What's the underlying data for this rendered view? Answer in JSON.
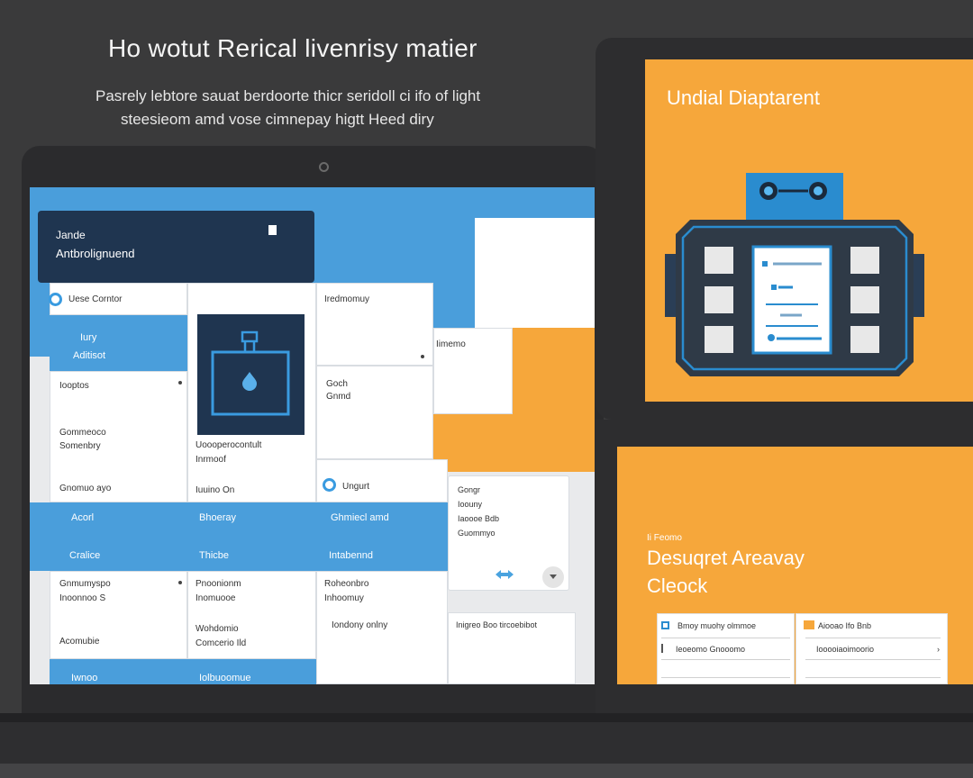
{
  "page": {
    "headline": "Ho wotut Rerical livenrisy matier",
    "subline_1": "Pasrely lebtore sauat berdoorte thicr seridoll ci ifo of light",
    "subline_2": "steesieom amd vose cimnepay higtt Heed diry"
  },
  "laptop": {
    "dark_card": {
      "line1": "Jande",
      "line2": "Antbrolignuend"
    },
    "row1": {
      "radio_label": "Uese Corntor",
      "mid_label": "Iredmomuy",
      "right_label": "Iimemo"
    },
    "col1": {
      "item1_a": "Iury",
      "item1_b": "Aditisot",
      "item2": "Iooptos",
      "item3_a": "Gommeoco",
      "item3_b": "Somenbry",
      "item4": "Gnomuo ayo"
    },
    "col2": {
      "caption_a": "Uoooperocontult",
      "caption_b": "Inrmoof",
      "caption_c": "Iuuino On"
    },
    "col3": {
      "item1_a": "Goch",
      "item1_b": "Gnmd",
      "radio_label": "Ungurt"
    },
    "col4": {
      "item1": "Gongr",
      "item2": "Ioouny",
      "item3": "Iaoooe Bdb",
      "item4": "Guommyo"
    },
    "blue_row1": {
      "a": "Acorl",
      "b": "Bhoeray",
      "c": "Ghmiecl amd"
    },
    "blue_row2": {
      "a": "Cralice",
      "b": "Thicbe",
      "c": "Intabennd"
    },
    "grid_bottom": {
      "a1": "Gnmumyspo",
      "a2": "Inoonnoo S",
      "a3": "Acomubie",
      "b1": "Pnoonionm",
      "b2": "Inomuooe",
      "b3": "Wohdomio",
      "b4": "Comcerio Ild",
      "c1": "Roheonbro",
      "c2": "Inhoomuy",
      "c3": "Iondony onlny",
      "d1": "Inigreo Boo tircoebibot"
    },
    "blue_row3": {
      "a": "Iwnoo",
      "b": "Iolbuoomue"
    }
  },
  "monitor1": {
    "title": "Undial Diaptarent"
  },
  "monitor2": {
    "small_label": "Ii Feomo",
    "title_1": "Desuqret Areavay",
    "title_2": "Cleock",
    "card1": {
      "header": "Bmoy muohy olmmoe",
      "row": "Ieoeomo Gnooomo"
    },
    "card2": {
      "header": "Aiooao Ifo Bnb",
      "row": "Iooooiaoimoorio"
    }
  },
  "colors": {
    "accent_blue": "#4a9edb",
    "accent_orange": "#f6a73b",
    "navy": "#1f3550",
    "background": "#3a3a3b"
  },
  "icons": [
    "document-icon",
    "radio-icon",
    "robot-icon",
    "drop-icon",
    "resize-arrows-icon",
    "chevron-down-icon"
  ]
}
